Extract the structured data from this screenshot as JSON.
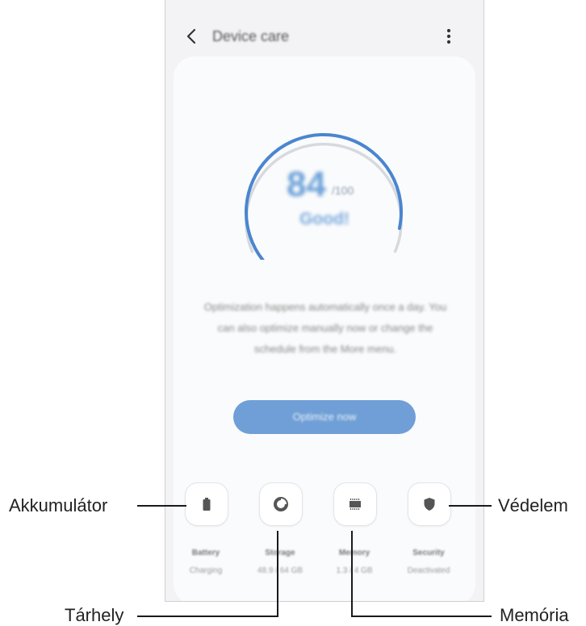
{
  "app": {
    "title": "Device care",
    "back_icon": "chevron-left-icon",
    "more_icon": "more-vertical-icon"
  },
  "score": {
    "value": "84",
    "max": "/100",
    "status": "Good!",
    "fraction": 0.84,
    "accent": "#4a86cf"
  },
  "description": "Optimization happens automatically once a day. You can also optimize manually now or change the schedule from the More menu.",
  "optimize_button": "Optimize now",
  "tiles": [
    {
      "icon": "battery-icon",
      "label": "Battery",
      "sub": "Charging"
    },
    {
      "icon": "storage-pie-icon",
      "label": "Storage",
      "sub": "48.9 / 64 GB"
    },
    {
      "icon": "memory-chip-icon",
      "label": "Memory",
      "sub": "1.3 / 4 GB"
    },
    {
      "icon": "shield-icon",
      "label": "Security",
      "sub": "Deactivated"
    }
  ],
  "callouts": {
    "battery": "Akkumulátor",
    "storage": "Tárhely",
    "memory": "Memória",
    "security": "Védelem"
  }
}
